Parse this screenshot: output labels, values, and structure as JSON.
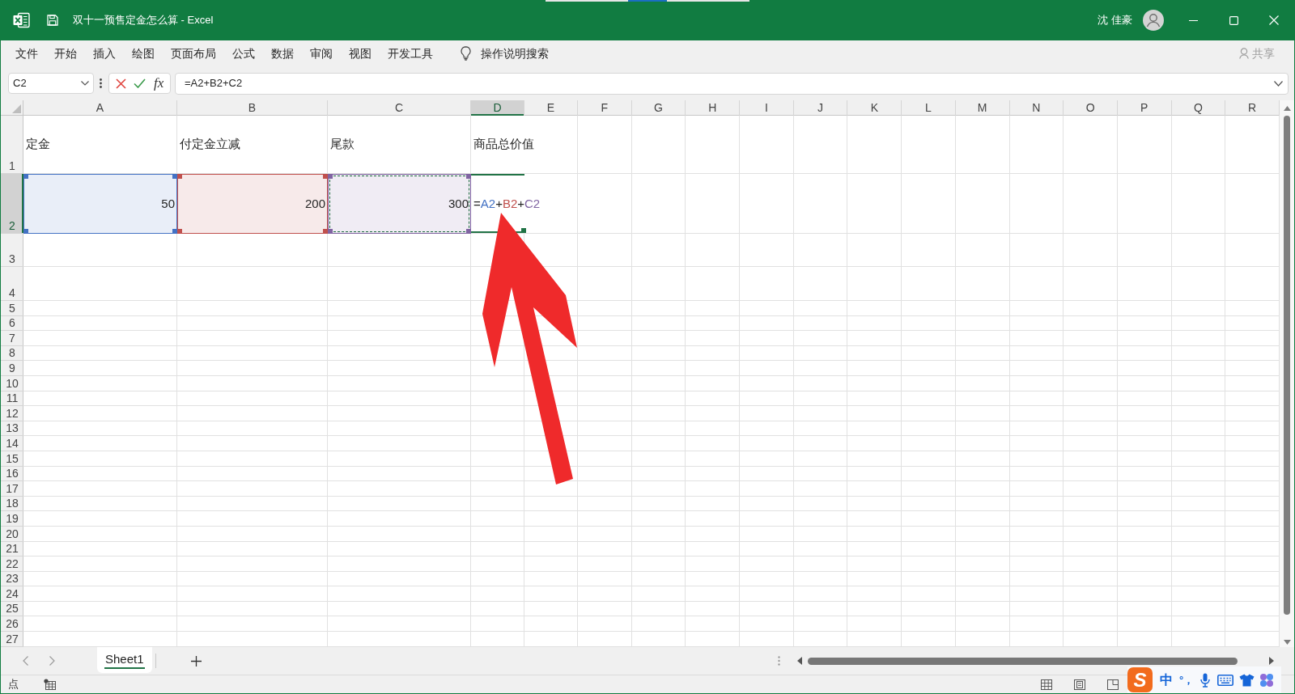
{
  "window": {
    "title": "双十一预售定金怎么算 - Excel",
    "user": "沈 佳豪"
  },
  "menu": {
    "items": [
      {
        "label": "文件",
        "selected": false
      },
      {
        "label": "开始",
        "selected": false
      },
      {
        "label": "插入",
        "selected": false
      },
      {
        "label": "绘图",
        "selected": false
      },
      {
        "label": "页面布局",
        "selected": false
      },
      {
        "label": "公式",
        "selected": false
      },
      {
        "label": "数据",
        "selected": false
      },
      {
        "label": "审阅",
        "selected": false
      },
      {
        "label": "视图",
        "selected": false
      },
      {
        "label": "开发工具",
        "selected": false
      }
    ],
    "tell_me": {
      "label": "操作说明搜索"
    },
    "share": {
      "label": "共享",
      "disabled": true
    }
  },
  "formula_bar": {
    "name_box": "C2",
    "function_button": "fx",
    "formula": "=A2+B2+C2"
  },
  "grid": {
    "columns": [
      {
        "label": "A",
        "selected": false
      },
      {
        "label": "B",
        "selected": false
      },
      {
        "label": "C",
        "selected": false
      },
      {
        "label": "D",
        "selected": true
      },
      {
        "label": "E",
        "selected": false
      },
      {
        "label": "F",
        "selected": false
      },
      {
        "label": "G",
        "selected": false
      },
      {
        "label": "H",
        "selected": false
      },
      {
        "label": "I",
        "selected": false
      },
      {
        "label": "J",
        "selected": false
      },
      {
        "label": "K",
        "selected": false
      },
      {
        "label": "L",
        "selected": false
      },
      {
        "label": "M",
        "selected": false
      },
      {
        "label": "N",
        "selected": false
      },
      {
        "label": "O",
        "selected": false
      },
      {
        "label": "P",
        "selected": false
      },
      {
        "label": "Q",
        "selected": false
      },
      {
        "label": "R",
        "selected": false
      }
    ],
    "rows": [
      {
        "label": "1",
        "selected": false,
        "cells": [
          {
            "kind": "text",
            "text": "定金"
          },
          {
            "kind": "text",
            "text": "付定金立减"
          },
          {
            "kind": "text",
            "text": "尾款"
          },
          {
            "kind": "text",
            "text": "商品总价值"
          }
        ]
      },
      {
        "label": "2",
        "selected": true,
        "cells": [
          {
            "kind": "value",
            "text": "50",
            "color": "#4472c4",
            "marquee": false
          },
          {
            "kind": "value",
            "text": "200",
            "color": "#c0504d",
            "marquee": false
          },
          {
            "kind": "value",
            "text": "300",
            "color": "#8064a2",
            "marquee": true
          },
          {
            "kind": "formula",
            "parts": [
              {
                "text": "=",
                "color": "#262626"
              },
              {
                "text": "A2",
                "color": "#4472c4"
              },
              {
                "text": "+",
                "color": "#262626"
              },
              {
                "text": "B2",
                "color": "#c0504d"
              },
              {
                "text": "+",
                "color": "#262626"
              },
              {
                "text": "C2",
                "color": "#8064a2"
              }
            ]
          }
        ]
      },
      {
        "label": "3",
        "selected": false
      },
      {
        "label": "4",
        "selected": false
      },
      {
        "label": "5",
        "selected": false
      },
      {
        "label": "6",
        "selected": false
      },
      {
        "label": "7",
        "selected": false
      },
      {
        "label": "8",
        "selected": false
      },
      {
        "label": "9",
        "selected": false
      },
      {
        "label": "10",
        "selected": false
      },
      {
        "label": "11",
        "selected": false
      },
      {
        "label": "12",
        "selected": false
      },
      {
        "label": "13",
        "selected": false
      },
      {
        "label": "14",
        "selected": false
      },
      {
        "label": "15",
        "selected": false
      },
      {
        "label": "16",
        "selected": false
      },
      {
        "label": "17",
        "selected": false
      },
      {
        "label": "18",
        "selected": false
      },
      {
        "label": "19",
        "selected": false
      },
      {
        "label": "20",
        "selected": false
      },
      {
        "label": "21",
        "selected": false
      },
      {
        "label": "22",
        "selected": false
      },
      {
        "label": "23",
        "selected": false
      },
      {
        "label": "24",
        "selected": false
      },
      {
        "label": "25",
        "selected": false
      },
      {
        "label": "26",
        "selected": false
      },
      {
        "label": "27",
        "selected": false
      }
    ]
  },
  "sheet_tabs": [
    {
      "label": "Sheet1",
      "selected": true
    }
  ],
  "status_bar": {
    "mode": "点"
  },
  "ime_toolbar": {
    "logo": "S",
    "language": "中",
    "punctuation": "°，"
  }
}
